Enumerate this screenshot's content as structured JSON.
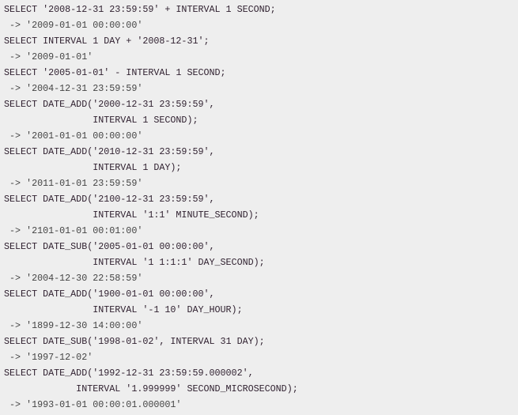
{
  "code_lines": [
    {
      "kind": "sql",
      "text": "SELECT '2008-12-31 23:59:59' + INTERVAL 1 SECOND;"
    },
    {
      "kind": "res",
      "text": " -> '2009-01-01 00:00:00'"
    },
    {
      "kind": "sql",
      "text": "SELECT INTERVAL 1 DAY + '2008-12-31';"
    },
    {
      "kind": "res",
      "text": " -> '2009-01-01'"
    },
    {
      "kind": "sql",
      "text": "SELECT '2005-01-01' - INTERVAL 1 SECOND;"
    },
    {
      "kind": "res",
      "text": " -> '2004-12-31 23:59:59'"
    },
    {
      "kind": "sql",
      "text": "SELECT DATE_ADD('2000-12-31 23:59:59',"
    },
    {
      "kind": "sql",
      "text": "                INTERVAL 1 SECOND);"
    },
    {
      "kind": "res",
      "text": " -> '2001-01-01 00:00:00'"
    },
    {
      "kind": "sql",
      "text": "SELECT DATE_ADD('2010-12-31 23:59:59',"
    },
    {
      "kind": "sql",
      "text": "                INTERVAL 1 DAY);"
    },
    {
      "kind": "res",
      "text": " -> '2011-01-01 23:59:59'"
    },
    {
      "kind": "sql",
      "text": "SELECT DATE_ADD('2100-12-31 23:59:59',"
    },
    {
      "kind": "sql",
      "text": "                INTERVAL '1:1' MINUTE_SECOND);"
    },
    {
      "kind": "res",
      "text": " -> '2101-01-01 00:01:00'"
    },
    {
      "kind": "sql",
      "text": "SELECT DATE_SUB('2005-01-01 00:00:00',"
    },
    {
      "kind": "sql",
      "text": "                INTERVAL '1 1:1:1' DAY_SECOND);"
    },
    {
      "kind": "res",
      "text": " -> '2004-12-30 22:58:59'"
    },
    {
      "kind": "sql",
      "text": "SELECT DATE_ADD('1900-01-01 00:00:00',"
    },
    {
      "kind": "sql",
      "text": "                INTERVAL '-1 10' DAY_HOUR);"
    },
    {
      "kind": "res",
      "text": " -> '1899-12-30 14:00:00'"
    },
    {
      "kind": "sql",
      "text": "SELECT DATE_SUB('1998-01-02', INTERVAL 31 DAY);"
    },
    {
      "kind": "res",
      "text": " -> '1997-12-02'"
    },
    {
      "kind": "sql",
      "text": "SELECT DATE_ADD('1992-12-31 23:59:59.000002',"
    },
    {
      "kind": "sql",
      "text": "             INTERVAL '1.999999' SECOND_MICROSECOND);"
    },
    {
      "kind": "res",
      "text": " -> '1993-01-01 00:00:01.000001'"
    }
  ]
}
